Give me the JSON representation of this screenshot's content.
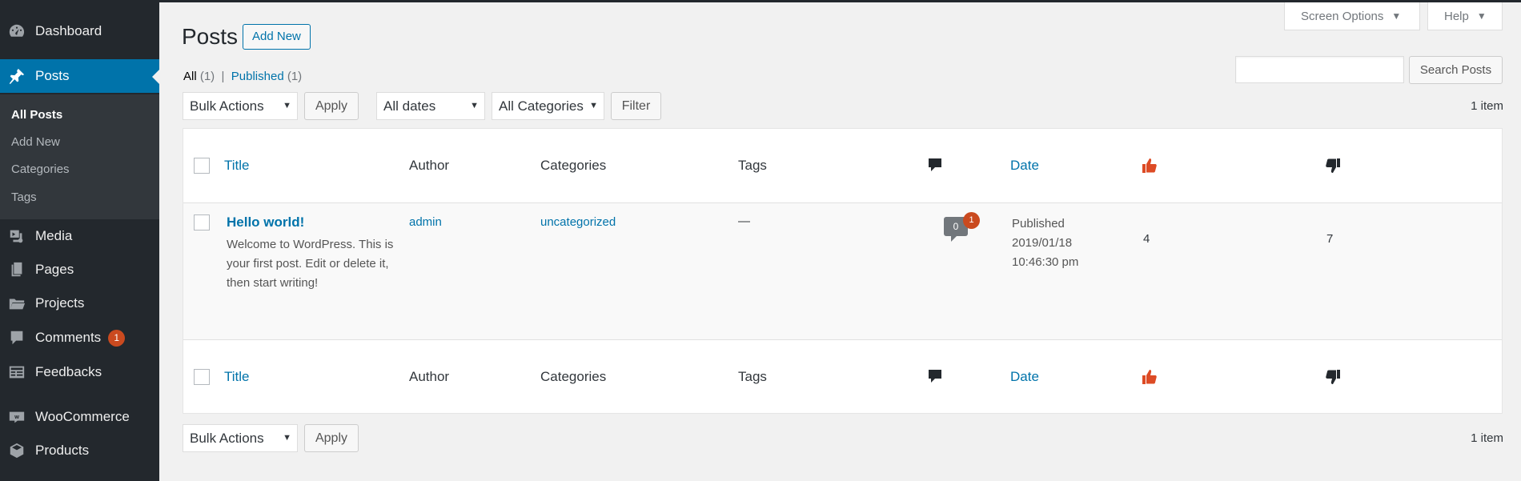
{
  "sidebar": {
    "items": [
      {
        "label": "Dashboard",
        "icon": "dashboard-icon"
      },
      {
        "label": "Posts",
        "icon": "pin-icon"
      },
      {
        "label": "Media",
        "icon": "media-icon"
      },
      {
        "label": "Pages",
        "icon": "pages-icon"
      },
      {
        "label": "Projects",
        "icon": "folder-icon"
      },
      {
        "label": "Comments",
        "icon": "comment-icon",
        "badge": "1"
      },
      {
        "label": "Feedbacks",
        "icon": "feedback-icon"
      },
      {
        "label": "WooCommerce",
        "icon": "woo-icon"
      },
      {
        "label": "Products",
        "icon": "box-icon"
      }
    ],
    "submenu": [
      "All Posts",
      "Add New",
      "Categories",
      "Tags"
    ]
  },
  "header": {
    "title": "Posts",
    "add_new": "Add New",
    "screen_options": "Screen Options",
    "help": "Help"
  },
  "filters": {
    "all_label": "All",
    "all_count": "(1)",
    "separator": "|",
    "published_label": "Published",
    "published_count": "(1)",
    "bulk_actions": "Bulk Actions",
    "apply": "Apply",
    "all_dates": "All dates",
    "all_categories": "All Categories",
    "filter": "Filter",
    "search_button": "Search Posts",
    "items_count": "1 item"
  },
  "table": {
    "columns": {
      "title": "Title",
      "author": "Author",
      "categories": "Categories",
      "tags": "Tags",
      "date": "Date"
    },
    "rows": [
      {
        "title": "Hello world!",
        "excerpt": "Welcome to WordPress. This is your first post. Edit or delete it, then start writing!",
        "author": "admin",
        "categories": "uncategorized",
        "tags": "—",
        "comments": "0",
        "pending_comments": "1",
        "status": "Published",
        "date": "2019/01/18",
        "time": "10:46:30 pm",
        "likes": "4",
        "dislikes": "7"
      }
    ]
  },
  "colors": {
    "accent": "#0073aa",
    "sidebar_bg": "#23282d",
    "badge": "#ca4a1f",
    "like": "#dd4b25"
  }
}
